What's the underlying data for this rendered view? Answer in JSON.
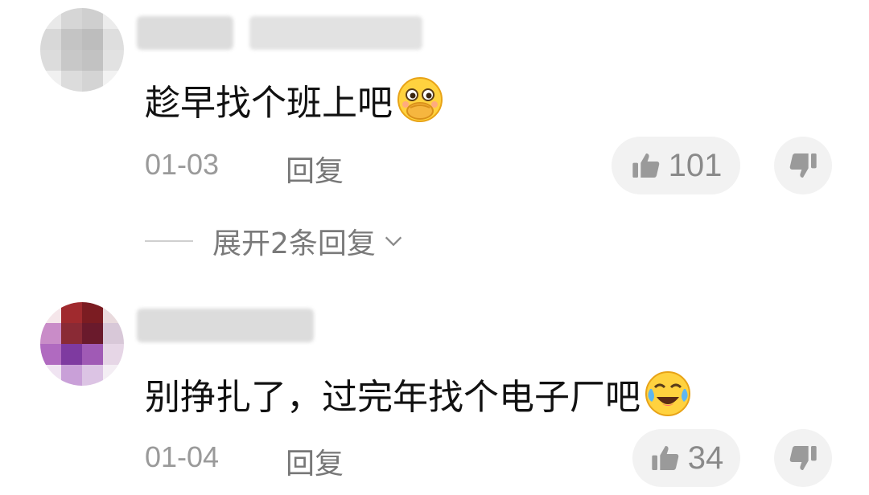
{
  "comments": [
    {
      "text": "趁早找个班上吧",
      "emoji": "hand-over-mouth-emoji",
      "date": "01-03",
      "reply_label": "回复",
      "likes": "101",
      "expand_label": "展开2条回复"
    },
    {
      "text": "别挣扎了，过完年找个电子厂吧",
      "emoji": "laughing-crying-emoji",
      "date": "01-04",
      "reply_label": "回复",
      "likes": "34"
    }
  ],
  "colors": {
    "text": "#111111",
    "meta": "#9a9a9a",
    "pill_bg": "#f2f2f2",
    "icon": "#8a8a8a"
  }
}
